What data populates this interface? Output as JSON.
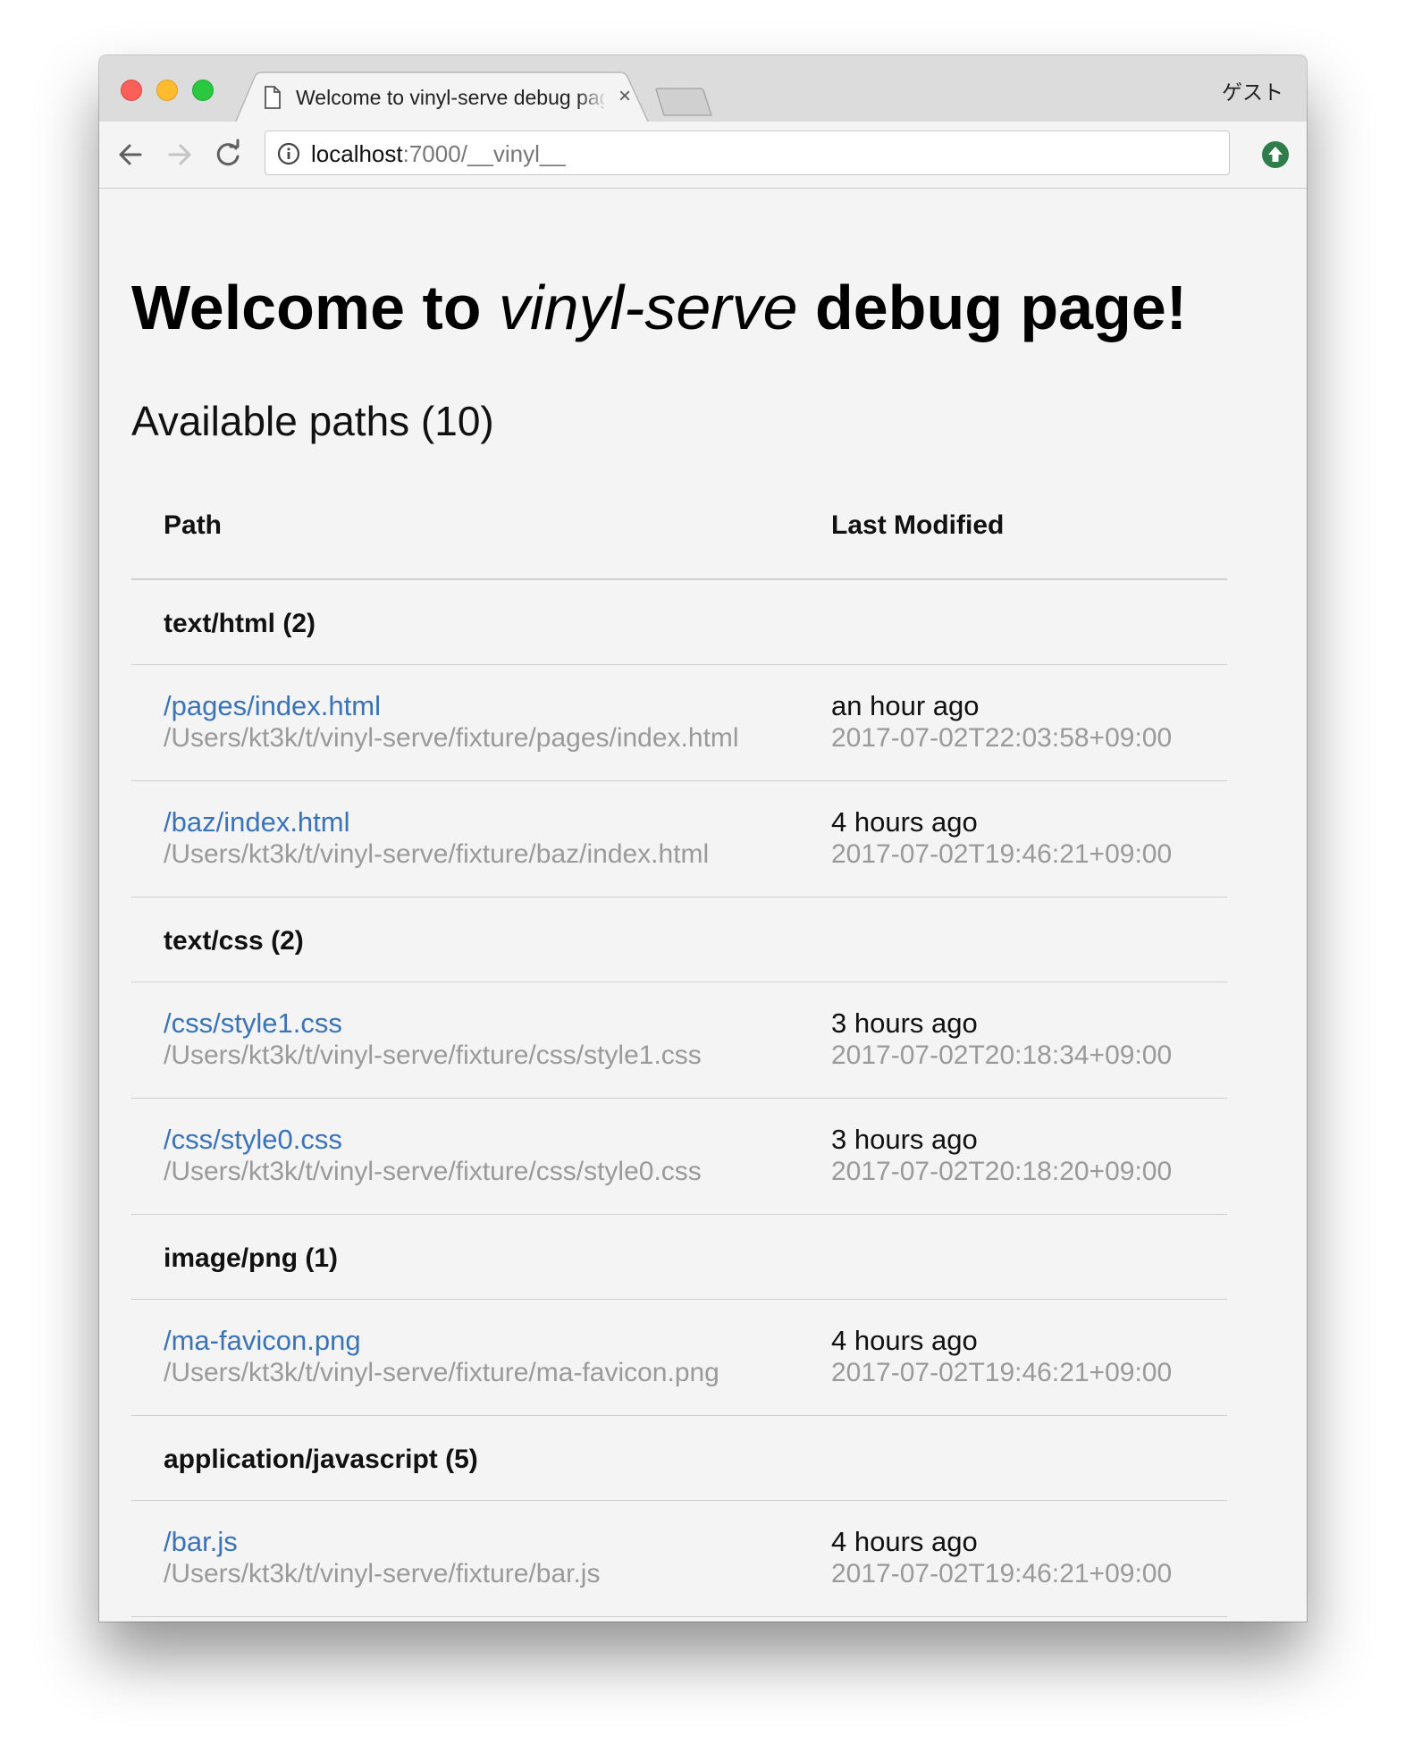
{
  "browser": {
    "tab_title": "Welcome to vinyl-serve debug page!",
    "tab_close": "×",
    "profile_label": "ゲスト",
    "url_host": "localhost",
    "url_rest": ":7000/__vinyl__"
  },
  "page": {
    "title_prefix": "Welcome to ",
    "title_em": "vinyl-serve",
    "title_suffix": " debug page!",
    "subtitle": "Available paths (10)",
    "columns": {
      "path": "Path",
      "last_modified": "Last Modified"
    },
    "groups": [
      {
        "label": "text/html (2)",
        "files": [
          {
            "url": "/pages/index.html",
            "fs_path": "/Users/kt3k/t/vinyl-serve/fixture/pages/index.html",
            "relative": "an hour ago",
            "timestamp": "2017-07-02T22:03:58+09:00"
          },
          {
            "url": "/baz/index.html",
            "fs_path": "/Users/kt3k/t/vinyl-serve/fixture/baz/index.html",
            "relative": "4 hours ago",
            "timestamp": "2017-07-02T19:46:21+09:00"
          }
        ]
      },
      {
        "label": "text/css (2)",
        "files": [
          {
            "url": "/css/style1.css",
            "fs_path": "/Users/kt3k/t/vinyl-serve/fixture/css/style1.css",
            "relative": "3 hours ago",
            "timestamp": "2017-07-02T20:18:34+09:00"
          },
          {
            "url": "/css/style0.css",
            "fs_path": "/Users/kt3k/t/vinyl-serve/fixture/css/style0.css",
            "relative": "3 hours ago",
            "timestamp": "2017-07-02T20:18:20+09:00"
          }
        ]
      },
      {
        "label": "image/png (1)",
        "files": [
          {
            "url": "/ma-favicon.png",
            "fs_path": "/Users/kt3k/t/vinyl-serve/fixture/ma-favicon.png",
            "relative": "4 hours ago",
            "timestamp": "2017-07-02T19:46:21+09:00"
          }
        ]
      },
      {
        "label": "application/javascript (5)",
        "files": [
          {
            "url": "/bar.js",
            "fs_path": "/Users/kt3k/t/vinyl-serve/fixture/bar.js",
            "relative": "4 hours ago",
            "timestamp": "2017-07-02T19:46:21+09:00"
          }
        ]
      }
    ]
  },
  "colors": {
    "link": "#3a73b8",
    "muted": "#9a9a9a",
    "extension_green": "#2e7d4a"
  }
}
